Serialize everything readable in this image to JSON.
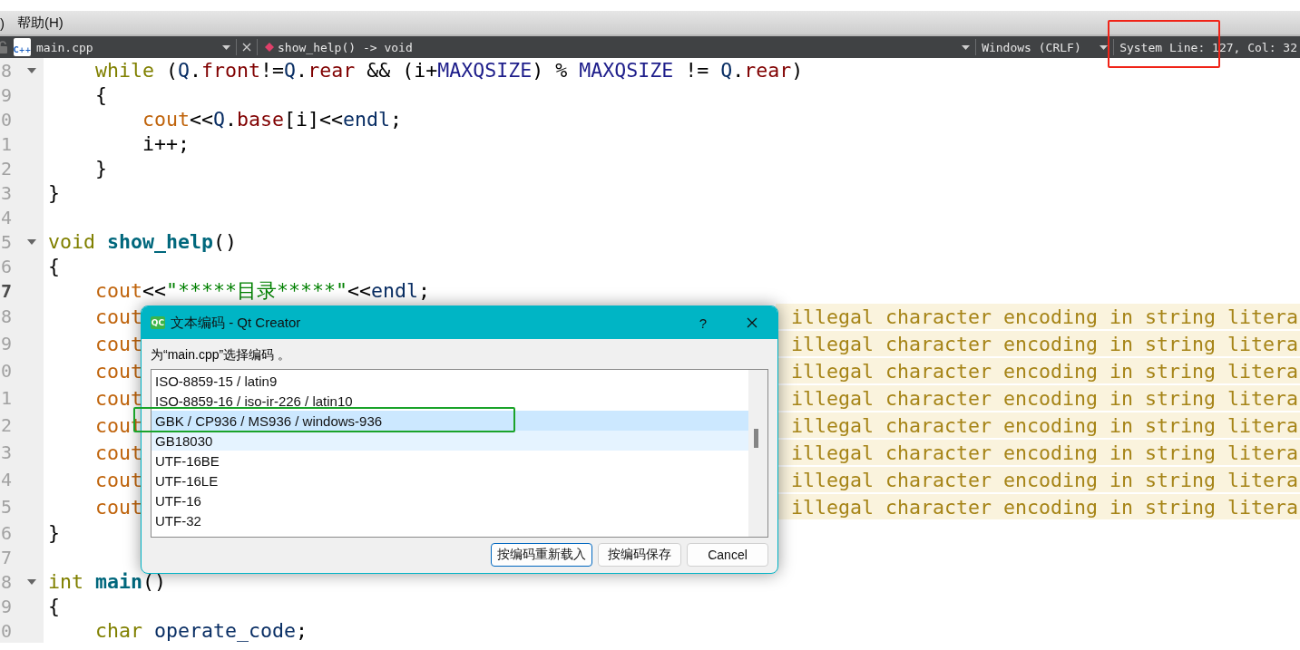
{
  "menu_bar": {
    "items": [
      {
        "label": ")"
      },
      {
        "label": "帮助(H)"
      }
    ]
  },
  "editor_toolbar": {
    "file_icon_label": "C++",
    "file_name": "main.cpp",
    "symbol": "show_help() -> void",
    "line_endings": "Windows (CRLF)",
    "encoding": "System",
    "position": "Line: 127, Col: 32"
  },
  "code_editor": {
    "lines": [
      {
        "number": "8",
        "foldable": true,
        "current": false,
        "tokens": [
          {
            "text": "    while",
            "kind": "keyword"
          },
          {
            "text": " (",
            "kind": "plain"
          },
          {
            "text": "Q",
            "kind": "variable"
          },
          {
            "text": ".",
            "kind": "plain"
          },
          {
            "text": "front",
            "kind": "member"
          },
          {
            "text": "!=",
            "kind": "plain"
          },
          {
            "text": "Q",
            "kind": "variable"
          },
          {
            "text": ".",
            "kind": "plain"
          },
          {
            "text": "rear",
            "kind": "member"
          },
          {
            "text": " && (i+",
            "kind": "plain"
          },
          {
            "text": "MAXQSIZE",
            "kind": "macro"
          },
          {
            "text": ") % ",
            "kind": "plain"
          },
          {
            "text": "MAXQSIZE",
            "kind": "macro"
          },
          {
            "text": " != ",
            "kind": "plain"
          },
          {
            "text": "Q",
            "kind": "variable"
          },
          {
            "text": ".",
            "kind": "plain"
          },
          {
            "text": "rear",
            "kind": "member"
          },
          {
            "text": ")",
            "kind": "plain"
          }
        ]
      },
      {
        "number": "9",
        "foldable": false,
        "current": false,
        "tokens": [
          {
            "text": "    {",
            "kind": "plain"
          }
        ]
      },
      {
        "number": "0",
        "foldable": false,
        "current": false,
        "tokens": [
          {
            "text": "        cout",
            "kind": "stream"
          },
          {
            "text": "<<",
            "kind": "plain"
          },
          {
            "text": "Q",
            "kind": "variable"
          },
          {
            "text": ".",
            "kind": "plain"
          },
          {
            "text": "base",
            "kind": "member"
          },
          {
            "text": "[i]<<",
            "kind": "plain"
          },
          {
            "text": "endl",
            "kind": "variable"
          },
          {
            "text": ";",
            "kind": "plain"
          }
        ]
      },
      {
        "number": "1",
        "foldable": false,
        "current": false,
        "tokens": [
          {
            "text": "        i++;",
            "kind": "plain"
          }
        ]
      },
      {
        "number": "2",
        "foldable": false,
        "current": false,
        "tokens": [
          {
            "text": "    }",
            "kind": "plain"
          }
        ]
      },
      {
        "number": "3",
        "foldable": false,
        "current": false,
        "tokens": [
          {
            "text": "}",
            "kind": "plain"
          }
        ]
      },
      {
        "number": "4",
        "foldable": false,
        "current": false
      },
      {
        "number": "5",
        "foldable": true,
        "current": false,
        "tokens": [
          {
            "text": "void ",
            "kind": "keyword"
          },
          {
            "text": "show_help",
            "kind": "function"
          },
          {
            "text": "()",
            "kind": "plain"
          }
        ]
      },
      {
        "number": "6",
        "foldable": false,
        "current": false,
        "tokens": [
          {
            "text": "{",
            "kind": "plain"
          }
        ]
      },
      {
        "number": "7",
        "foldable": false,
        "current": true,
        "tokens": [
          {
            "text": "    cout",
            "kind": "stream"
          },
          {
            "text": "<<",
            "kind": "plain"
          },
          {
            "text": "\"*****目录*****\"",
            "kind": "string"
          },
          {
            "text": "<<",
            "kind": "plain"
          },
          {
            "text": "endl",
            "kind": "variable"
          },
          {
            "text": ";",
            "kind": "plain"
          }
        ]
      },
      {
        "number": "8",
        "foldable": false,
        "current": false,
        "tokens": [
          {
            "text": "    cout",
            "kind": "stream"
          }
        ],
        "warning": "illegal character encoding in string litera"
      },
      {
        "number": "9",
        "foldable": false,
        "current": false,
        "tokens": [
          {
            "text": "    cout",
            "kind": "stream"
          }
        ],
        "warning": "illegal character encoding in string litera"
      },
      {
        "number": "0",
        "foldable": false,
        "current": false,
        "tokens": [
          {
            "text": "    cout",
            "kind": "stream"
          }
        ],
        "warning": "illegal character encoding in string litera"
      },
      {
        "number": "1",
        "foldable": false,
        "current": false,
        "tokens": [
          {
            "text": "    cout",
            "kind": "stream"
          }
        ],
        "warning": "illegal character encoding in string litera"
      },
      {
        "number": "2",
        "foldable": false,
        "current": false,
        "tokens": [
          {
            "text": "    cout",
            "kind": "stream"
          }
        ],
        "warning": "illegal character encoding in string litera"
      },
      {
        "number": "3",
        "foldable": false,
        "current": false,
        "tokens": [
          {
            "text": "    cout",
            "kind": "stream"
          }
        ],
        "warning": "illegal character encoding in string litera"
      },
      {
        "number": "4",
        "foldable": false,
        "current": false,
        "tokens": [
          {
            "text": "    cout",
            "kind": "stream"
          }
        ],
        "warning": "illegal character encoding in string litera"
      },
      {
        "number": "5",
        "foldable": false,
        "current": false,
        "tokens": [
          {
            "text": "    cout",
            "kind": "stream"
          }
        ],
        "warning": "illegal character encoding in string litera"
      },
      {
        "number": "6",
        "foldable": false,
        "current": false,
        "tokens": [
          {
            "text": "}",
            "kind": "plain"
          }
        ]
      },
      {
        "number": "7",
        "foldable": false,
        "current": false
      },
      {
        "number": "8",
        "foldable": true,
        "current": false,
        "tokens": [
          {
            "text": "int ",
            "kind": "keyword"
          },
          {
            "text": "main",
            "kind": "function"
          },
          {
            "text": "()",
            "kind": "plain"
          }
        ]
      },
      {
        "number": "9",
        "foldable": false,
        "current": false,
        "tokens": [
          {
            "text": "{",
            "kind": "plain"
          }
        ]
      },
      {
        "number": "0",
        "foldable": false,
        "current": false,
        "tokens": [
          {
            "text": "    char ",
            "kind": "keyword"
          },
          {
            "text": "operate_code",
            "kind": "variable"
          },
          {
            "text": ";",
            "kind": "plain"
          }
        ]
      }
    ]
  },
  "dialog": {
    "icon_label": "QC",
    "title": "文本编码 - Qt Creator",
    "help_label": "?",
    "prompt": "为“main.cpp”选择编码 。",
    "encodings": [
      {
        "label": "ISO-8859-15 / latin9",
        "selected": false,
        "hovered": false
      },
      {
        "label": "ISO-8859-16 / iso-ir-226 / latin10",
        "selected": false,
        "hovered": false
      },
      {
        "label": "GBK / CP936 / MS936 / windows-936",
        "selected": true,
        "hovered": false
      },
      {
        "label": "GB18030",
        "selected": false,
        "hovered": true
      },
      {
        "label": "UTF-16BE",
        "selected": false,
        "hovered": false
      },
      {
        "label": "UTF-16LE",
        "selected": false,
        "hovered": false
      },
      {
        "label": "UTF-16",
        "selected": false,
        "hovered": false
      },
      {
        "label": "UTF-32",
        "selected": false,
        "hovered": false
      }
    ],
    "buttons": [
      {
        "label": "按编码重新载入",
        "default": true
      },
      {
        "label": "按编码保存",
        "default": false
      },
      {
        "label": "Cancel",
        "default": false
      }
    ]
  },
  "markup_frames": [
    {
      "color": "#f02418"
    },
    {
      "color": "#1aa32a"
    }
  ]
}
